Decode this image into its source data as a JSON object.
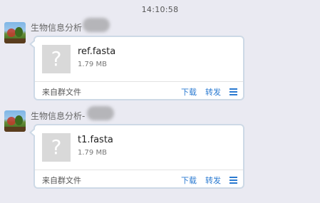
{
  "timestamp": "14:10:58",
  "messages": [
    {
      "sender": "生物信息分析",
      "file": {
        "name": "ref.fasta",
        "size": "1.79 MB",
        "icon": "unknown-file-icon",
        "icon_glyph": "?"
      },
      "source_label": "来自群文件",
      "actions": {
        "download": "下载",
        "forward": "转发"
      }
    },
    {
      "sender": "生物信息分析-",
      "file": {
        "name": "t1.fasta",
        "size": "1.79 MB",
        "icon": "unknown-file-icon",
        "icon_glyph": "?"
      },
      "source_label": "来自群文件",
      "actions": {
        "download": "下载",
        "forward": "转发"
      }
    }
  ],
  "colors": {
    "background": "#eaeaf2",
    "link": "#2a7ad1",
    "bubble_border": "#cdd9e6"
  }
}
